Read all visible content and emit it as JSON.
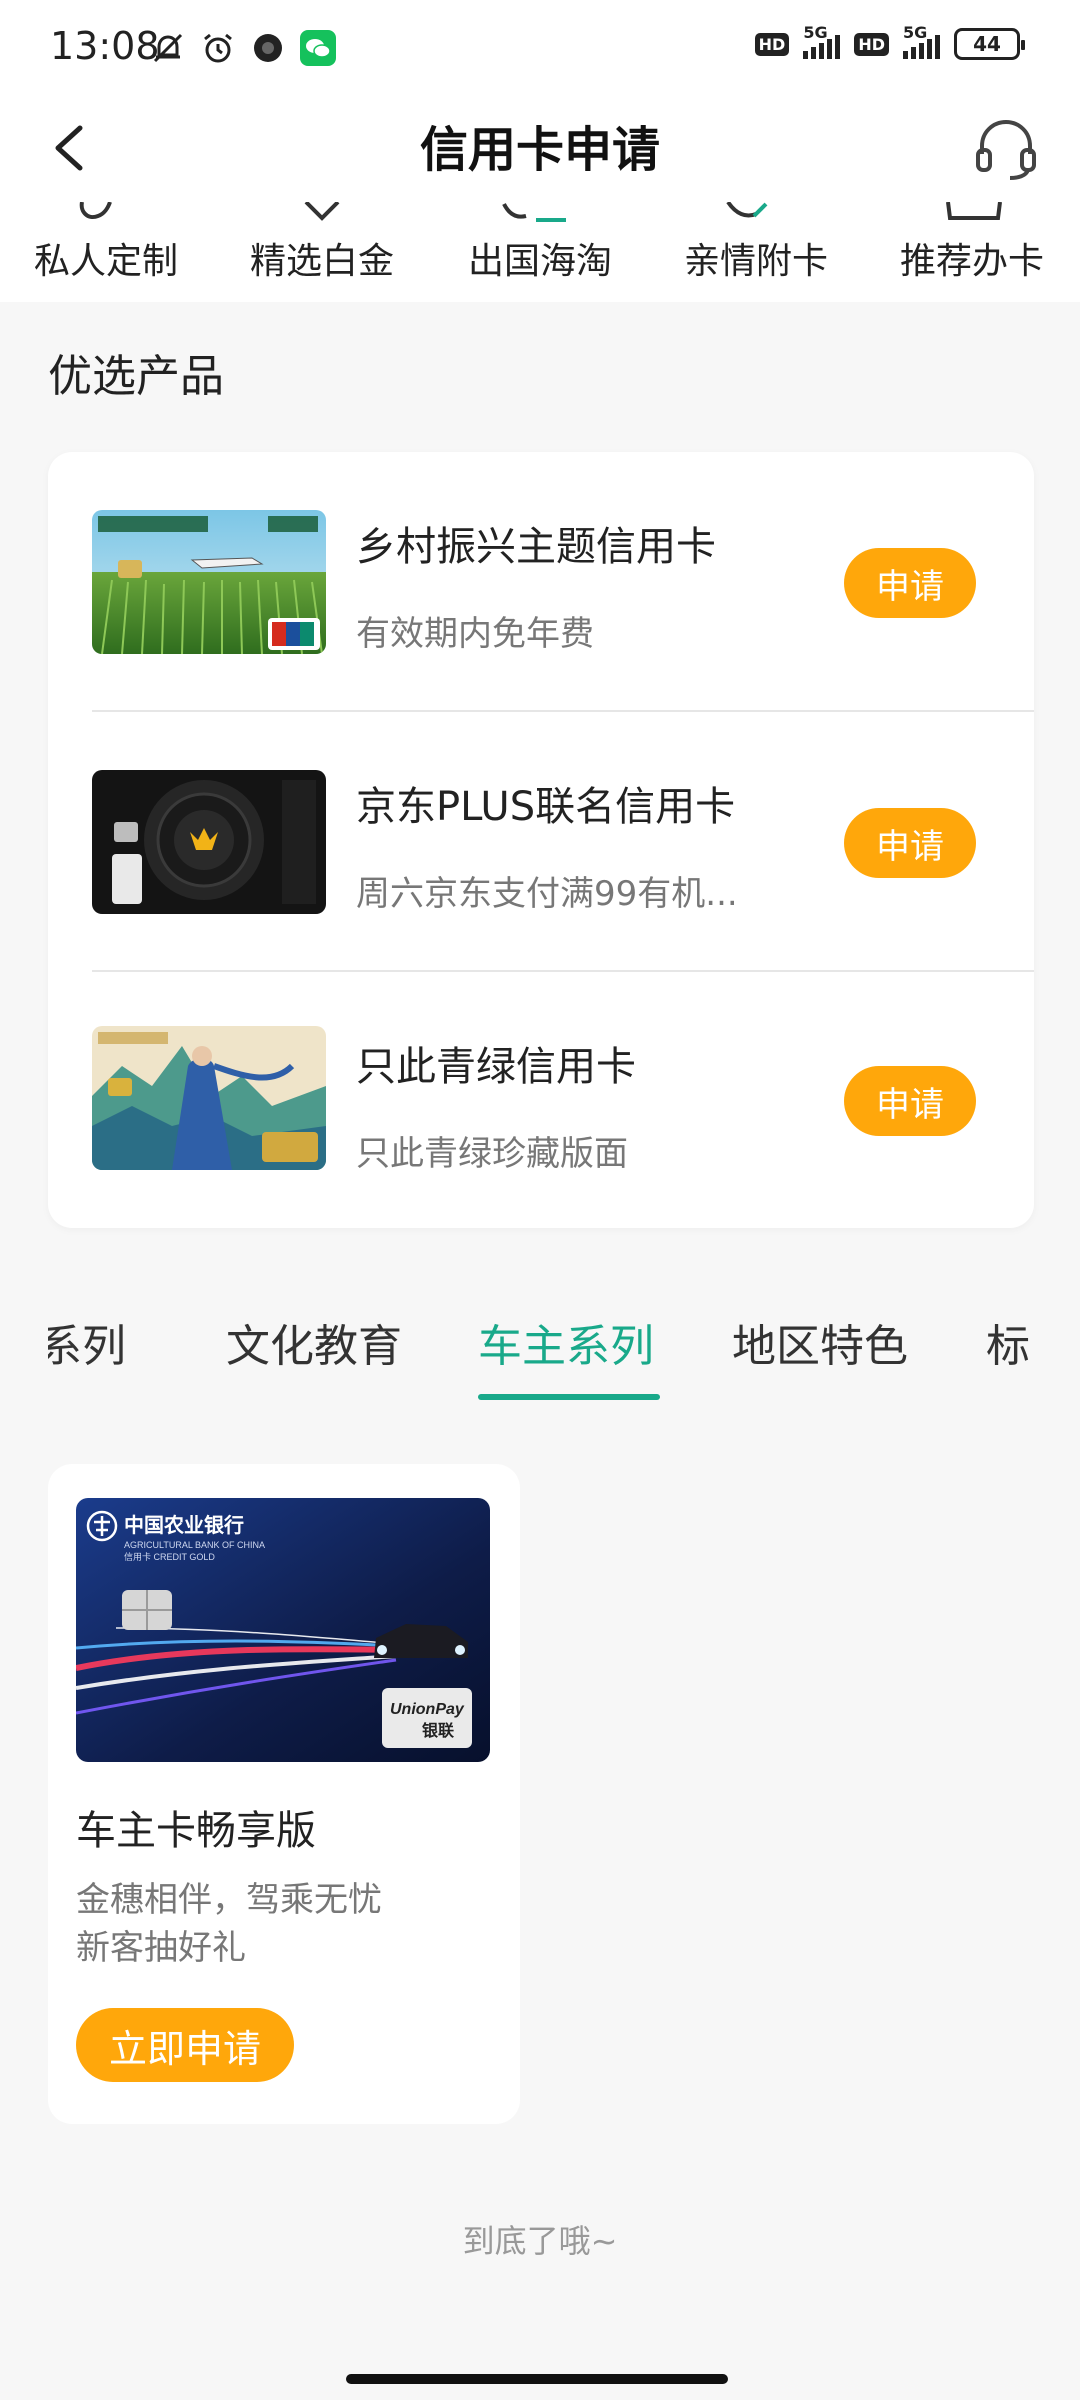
{
  "status_bar": {
    "time": "13:08",
    "signal1_label": "5G",
    "signal2_label": "5G",
    "hd1": "HD",
    "hd2": "HD",
    "battery": "44",
    "icons": [
      "mute-bell-icon",
      "alarm-icon",
      "circle-app-icon",
      "wechat-icon"
    ]
  },
  "header": {
    "title": "信用卡申请",
    "back_icon": "chevron-left-icon",
    "service_icon": "headset-icon"
  },
  "categories": [
    {
      "label": "私人定制"
    },
    {
      "label": "精选白金"
    },
    {
      "label": "出国海淘"
    },
    {
      "label": "亲情附卡"
    },
    {
      "label": "推荐办卡"
    }
  ],
  "section_title": "优选产品",
  "products": [
    {
      "name": "乡村振兴主题信用卡",
      "desc": "有效期内免年费",
      "button": "申请"
    },
    {
      "name": "京东PLUS联名信用卡",
      "desc": "周六京东支付满99有机...",
      "button": "申请"
    },
    {
      "name": "只此青绿信用卡",
      "desc": "只此青绿珍藏版面",
      "button": "申请"
    }
  ],
  "tabs": [
    {
      "label": "系列"
    },
    {
      "label": "文化教育"
    },
    {
      "label": "车主系列"
    },
    {
      "label": "地区特色"
    },
    {
      "label": "标"
    }
  ],
  "featured": {
    "name": "车主卡畅享版",
    "desc_line1": "金穗相伴，驾乘无忧",
    "desc_line2": "新客抽好礼",
    "button": "立即申请",
    "card_bank_name": "中国农业银行",
    "card_bank_en": "AGRICULTURAL BANK OF CHINA",
    "card_type": "信用卡   CREDIT GOLD",
    "card_network": "UnionPay",
    "card_network_cn": "银联"
  },
  "bottom_text": "到底了哦~",
  "colors": {
    "accent_green": "#19a98a",
    "button_orange": "#ffa70b"
  }
}
